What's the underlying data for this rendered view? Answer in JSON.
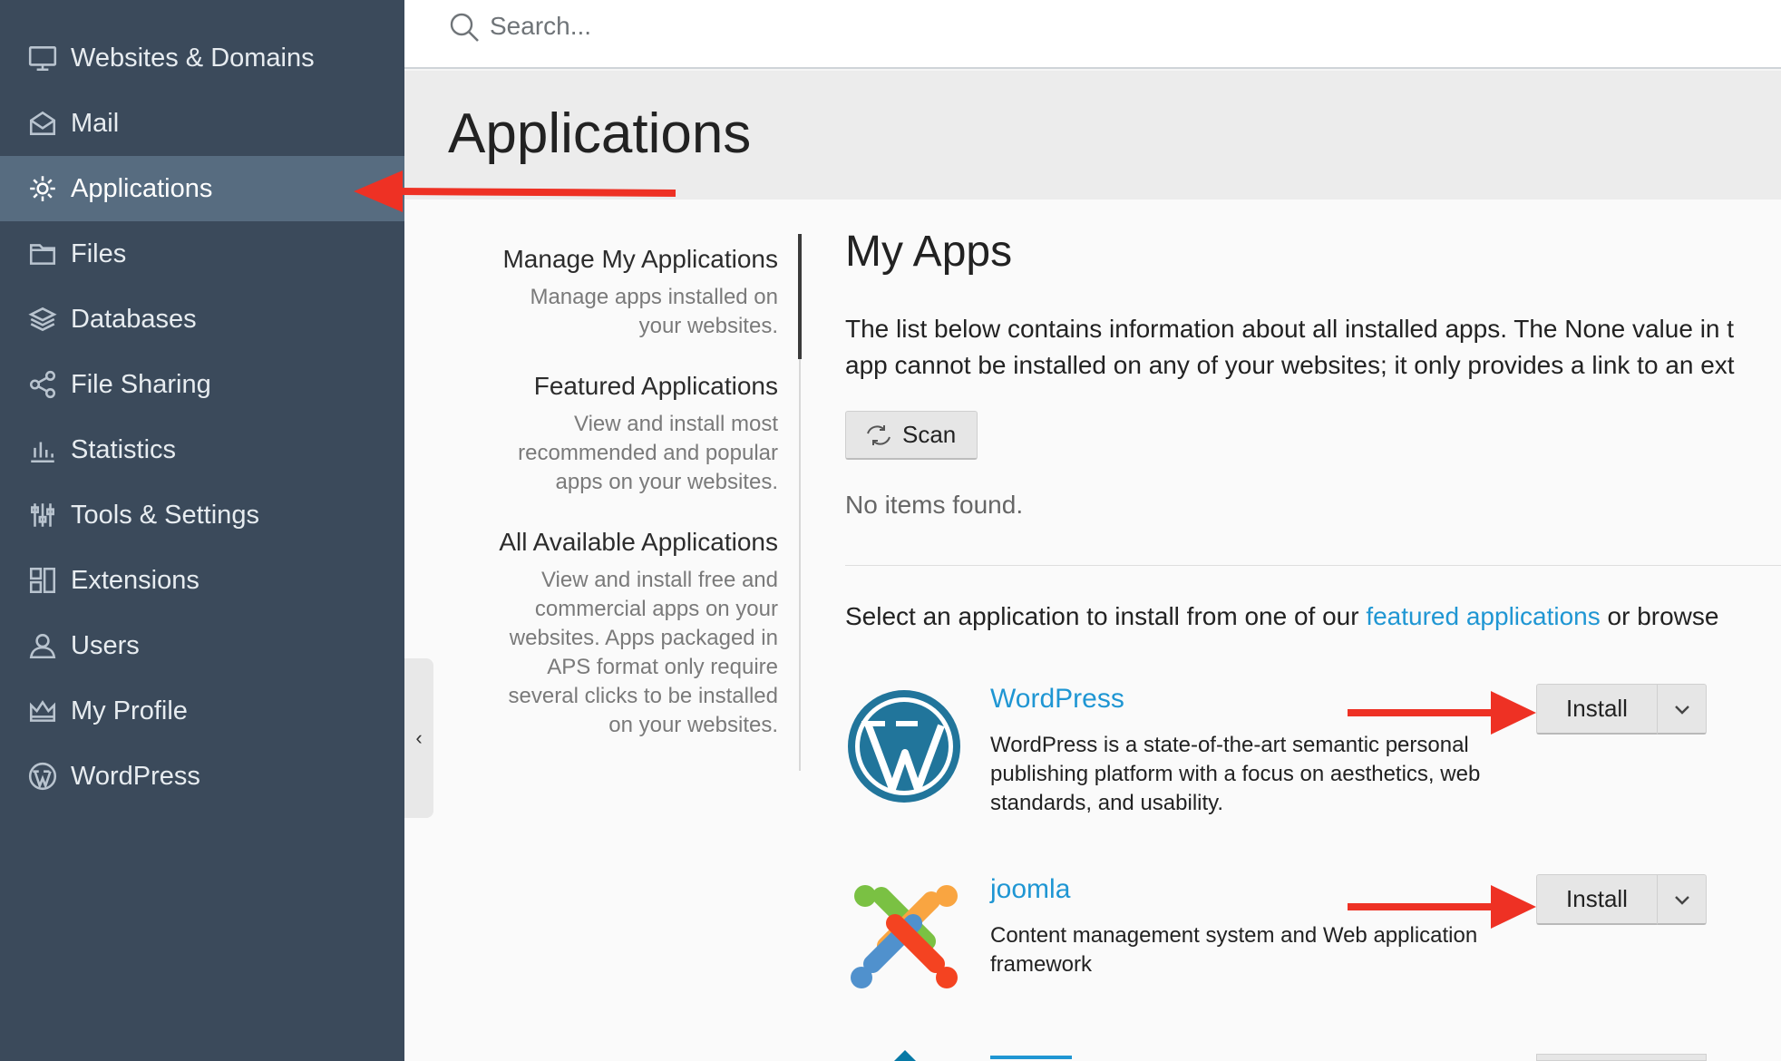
{
  "sidebar": {
    "items": [
      {
        "label": "Websites & Domains",
        "icon": "monitor-icon"
      },
      {
        "label": "Mail",
        "icon": "mail-icon"
      },
      {
        "label": "Applications",
        "icon": "gear-icon",
        "active": true
      },
      {
        "label": "Files",
        "icon": "folder-icon"
      },
      {
        "label": "Databases",
        "icon": "database-icon"
      },
      {
        "label": "File Sharing",
        "icon": "share-icon"
      },
      {
        "label": "Statistics",
        "icon": "bar-chart-icon"
      },
      {
        "label": "Tools & Settings",
        "icon": "sliders-icon"
      },
      {
        "label": "Extensions",
        "icon": "extensions-icon"
      },
      {
        "label": "Users",
        "icon": "user-icon"
      },
      {
        "label": "My Profile",
        "icon": "crown-icon"
      },
      {
        "label": "WordPress",
        "icon": "wordpress-icon"
      }
    ]
  },
  "search": {
    "placeholder": "Search..."
  },
  "page": {
    "title": "Applications"
  },
  "subnav": [
    {
      "title": "Manage My Applications",
      "desc": "Manage apps installed on your websites."
    },
    {
      "title": "Featured Applications",
      "desc": "View and install most recommended and popular apps on your websites."
    },
    {
      "title": "All Available Applications",
      "desc": "View and install free and commercial apps on your websites. Apps packaged in APS format only require several clicks to be installed on your websites."
    }
  ],
  "main": {
    "heading": "My Apps",
    "desc_line1": "The list below contains information about all installed apps. The None value in t",
    "desc_line2": "app cannot be installed on any of your websites; it only provides a link to an ext",
    "scan_label": "Scan",
    "empty": "No items found.",
    "select_prefix": "Select an application to install from one of our ",
    "select_link": "featured applications",
    "select_suffix": " or browse"
  },
  "apps": [
    {
      "name": "WordPress",
      "desc": "WordPress is a state-of-the-art semantic personal publishing platform with a focus on aesthetics, web standards, and usability.",
      "install_label": "Install"
    },
    {
      "name": "joomla",
      "desc": "Content management system and Web application framework",
      "install_label": "Install"
    }
  ],
  "colors": {
    "sidebar_bg": "#3b4a5b",
    "sidebar_active": "#576c80",
    "link": "#1f96d3",
    "annotation_arrow": "#ee3124"
  }
}
